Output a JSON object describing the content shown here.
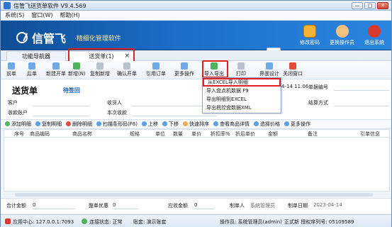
{
  "window": {
    "title": "信管飞送货单软件 V9.4.569"
  },
  "menubar": [
    "系统(S)",
    "窗口(W)",
    "帮助(H)"
  ],
  "banner": {
    "logo": "信管飞",
    "tagline": "·精细化管理软件",
    "actions": [
      "修改密码",
      "更换操作员",
      "退出系统"
    ]
  },
  "tabs": [
    {
      "label": "功能导航器"
    },
    {
      "label": "送货单(1)"
    }
  ],
  "toolbar": {
    "items": [
      "前单",
      "后单",
      "新建开单",
      "新增(N)",
      "复制新增",
      "确认开单",
      "引用订单",
      "更多操作",
      "导入导出",
      "打印",
      "界面设计",
      "关闭窗口"
    ]
  },
  "dropdown": {
    "items": [
      "从EXCEL导入明细",
      "导入盘点机数据  F9",
      "导出明细到EXCEL",
      "导出税控盘数据XML"
    ]
  },
  "form": {
    "doc_title": "送货单",
    "status": "待签回",
    "labels": {
      "customer": "客户",
      "receiver": "收货人",
      "collect_account": "收款账户",
      "this_payment": "本次收款",
      "doc_no": "单据编号",
      "settlement": "结算方式"
    },
    "date_text": "4-14 11:06"
  },
  "subtoolbar": [
    "添加明细",
    "复制明细",
    "删除明细",
    "扫描条形码(F6)",
    "上移",
    "下移",
    "快速排序",
    "查看商品详情",
    "选择价格",
    "更多操作"
  ],
  "grid": {
    "headers": [
      "序号",
      "商品编码",
      "商品名称",
      "规格",
      "单位",
      "数量",
      "单价",
      "折扣率%",
      "折后单价",
      "金额",
      "备注",
      "引单信息"
    ]
  },
  "footer": {
    "total_label": "合计金额",
    "total_value": "0",
    "discount_label": "整单优惠",
    "discount_value": "0",
    "due_label": "应收金额",
    "due_value": "0",
    "maker_label": "制单人",
    "maker_value": "系统管理员",
    "date_label": "制单日期",
    "date_value": "2023-04-14"
  },
  "statusbar": {
    "center": "应用中心: 127.0.0.1:7093",
    "conn": "连接状态: 正常",
    "account": "账套: 演示账套",
    "operator": "操作员: 系统管理员(admin)",
    "license": "正式新  授权序列号: 05109589"
  }
}
